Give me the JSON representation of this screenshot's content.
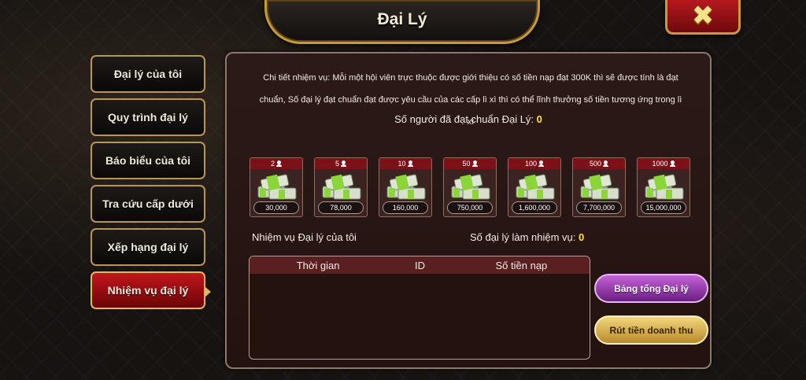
{
  "header": {
    "title": "Đại Lý",
    "close_icon": "close-x-icon"
  },
  "sidebar": {
    "items": [
      {
        "label": "Đại lý của tôi",
        "active": false
      },
      {
        "label": "Quy trình đại lý",
        "active": false
      },
      {
        "label": "Báo biểu của tôi",
        "active": false
      },
      {
        "label": "Tra cứu cấp dưới",
        "active": false
      },
      {
        "label": "Xếp hạng đại lý",
        "active": false
      },
      {
        "label": "Nhiệm vụ đại lý",
        "active": true
      }
    ]
  },
  "panel": {
    "description": "Chi tiết nhiệm vụ: Mỗi một hội viên trực thuộc được giới thiệu có số tiền nạp đạt 300K thì sẽ được tính là đạt chuẩn, Số đại lý đạt chuẩn đạt được yêu cầu của các cấp lì xì thì có thể lĩnh thưởng số tiền tương ứng trong lì xì",
    "qualified_label": "Số người đã đạt chuẩn Đại Lý:",
    "qualified_value": "0",
    "rewards": [
      {
        "count": "2",
        "amount": "30,000"
      },
      {
        "count": "5",
        "amount": "78,000"
      },
      {
        "count": "10",
        "amount": "160,000"
      },
      {
        "count": "50",
        "amount": "750,000"
      },
      {
        "count": "100",
        "amount": "1,600,000"
      },
      {
        "count": "500",
        "amount": "7,700,000"
      },
      {
        "count": "1000",
        "amount": "15,000,000"
      }
    ],
    "my_tasks_label": "Nhiệm vụ Đại lý của tôi",
    "task_agents_label": "Số đại lý làm nhiệm vụ:",
    "task_agents_value": "0",
    "table": {
      "columns": [
        "Thời gian",
        "ID",
        "Số tiền nạp"
      ],
      "rows": []
    },
    "buttons": {
      "summary": "Bảng tổng Đại lý",
      "withdraw": "Rút tiền doanh thu"
    }
  },
  "colors": {
    "accent_gold": "#c79a3c",
    "active_red": "#c2161c",
    "highlight_yellow": "#ffe33a",
    "purple_button": "#9b3fb5",
    "gold_button": "#dcb35a"
  }
}
